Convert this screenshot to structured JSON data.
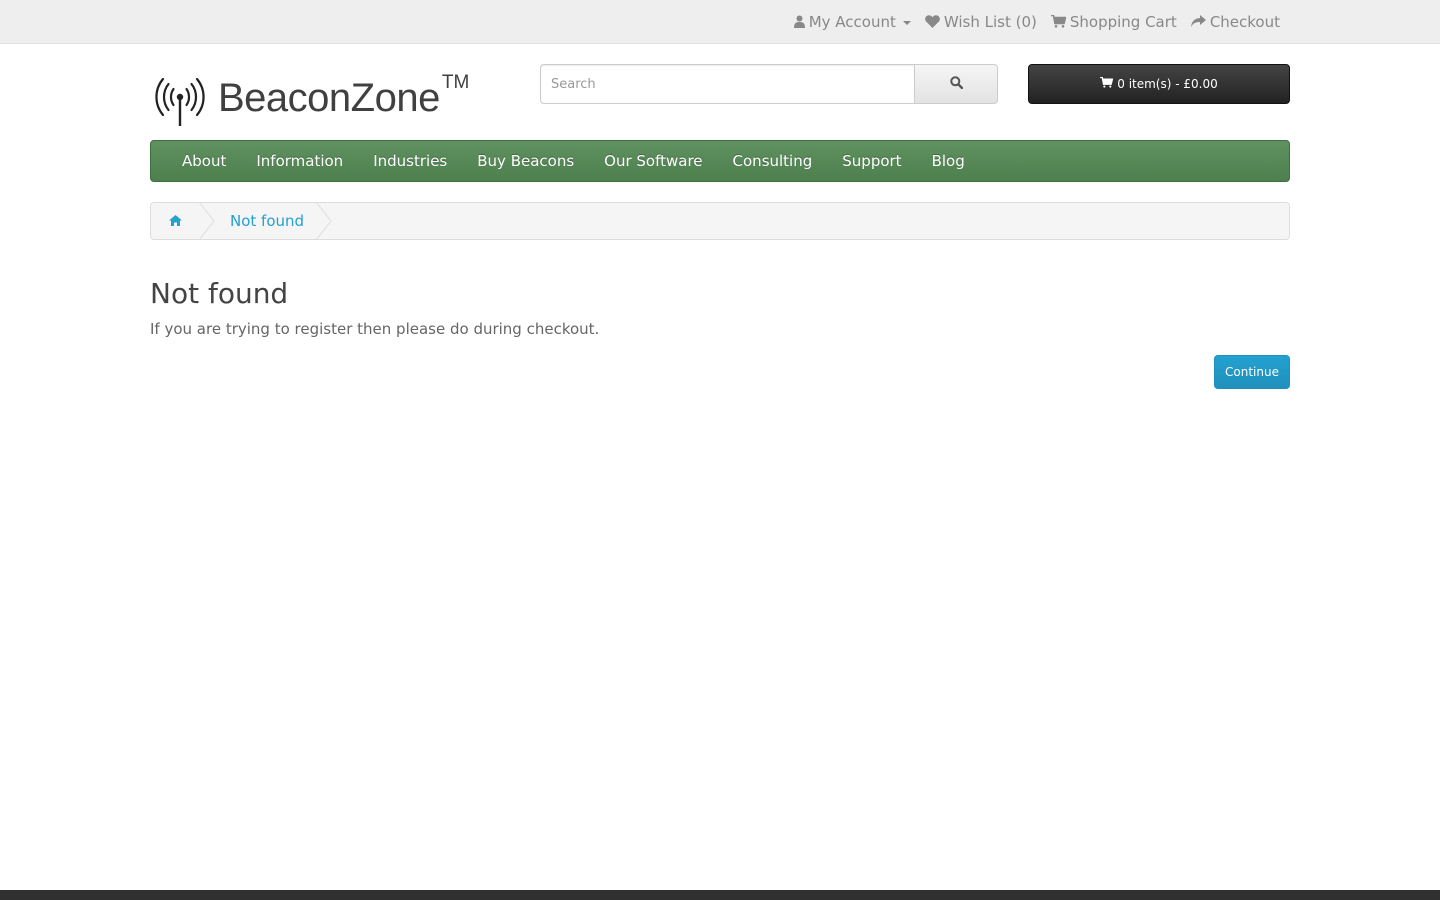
{
  "topbar": {
    "my_account": "My Account",
    "wish_list": "Wish List (0)",
    "shopping_cart": "Shopping Cart",
    "checkout": "Checkout"
  },
  "header": {
    "logo_text": "BeaconZone",
    "logo_tm": "TM",
    "search_placeholder": "Search",
    "cart_button": "0 item(s) - £0.00"
  },
  "nav": {
    "items": [
      "About",
      "Information",
      "Industries",
      "Buy Beacons",
      "Our Software",
      "Consulting",
      "Support",
      "Blog"
    ]
  },
  "breadcrumb": {
    "current": "Not found"
  },
  "main": {
    "title": "Not found",
    "message": "If you are trying to register then please do during checkout.",
    "continue_label": "Continue"
  },
  "colors": {
    "nav_green": "#5b8c5b",
    "link_blue": "#23a1d1",
    "cart_dark": "#333333"
  }
}
